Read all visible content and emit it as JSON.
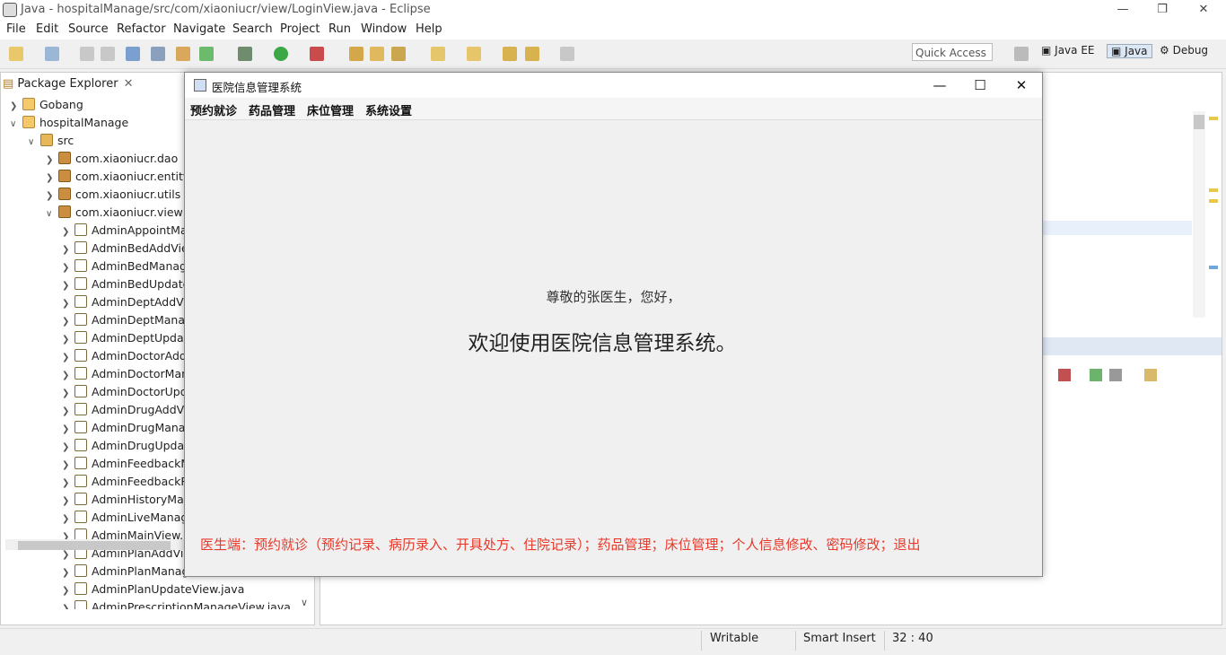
{
  "eclipse": {
    "window_title": "Java - hospitalManage/src/com/xiaoniucr/view/LoginView.java - Eclipse",
    "menu": [
      "File",
      "Edit",
      "Source",
      "Refactor",
      "Navigate",
      "Search",
      "Project",
      "Run",
      "Window",
      "Help"
    ],
    "quick_access": "Quick Access",
    "perspectives": [
      "Java EE",
      "Java",
      "Debug"
    ],
    "package_explorer": {
      "tab_label": "Package Explorer",
      "items": [
        {
          "label": "Gobang"
        },
        {
          "label": "hospitalManage"
        },
        {
          "label": "src"
        },
        {
          "label": "com.xiaoniucr.dao"
        },
        {
          "label": "com.xiaoniucr.entity"
        },
        {
          "label": "com.xiaoniucr.utils"
        },
        {
          "label": "com.xiaoniucr.view"
        },
        {
          "label": "AdminAppointMa"
        },
        {
          "label": "AdminBedAddVie"
        },
        {
          "label": "AdminBedManag"
        },
        {
          "label": "AdminBedUpdate"
        },
        {
          "label": "AdminDeptAddVi"
        },
        {
          "label": "AdminDeptManag"
        },
        {
          "label": "AdminDeptUpdat"
        },
        {
          "label": "AdminDoctorAdd"
        },
        {
          "label": "AdminDoctorMan"
        },
        {
          "label": "AdminDoctorUpd"
        },
        {
          "label": "AdminDrugAddVi"
        },
        {
          "label": "AdminDrugMana"
        },
        {
          "label": "AdminDrugUpdat"
        },
        {
          "label": "AdminFeedbackM"
        },
        {
          "label": "AdminFeedbackR"
        },
        {
          "label": "AdminHistoryMan"
        },
        {
          "label": "AdminLiveManag"
        },
        {
          "label": "AdminMainView.j"
        },
        {
          "label": "AdminPlanAddVie"
        },
        {
          "label": "AdminPlanManag"
        },
        {
          "label": "AdminPlanUpdateView.java"
        },
        {
          "label": "AdminPrescriptionManageView.java"
        }
      ]
    },
    "status": {
      "writable": "Writable",
      "insert_mode": "Smart Insert",
      "position": "32 : 40"
    }
  },
  "dialog": {
    "title": "医院信息管理系统",
    "menu": [
      "预约就诊",
      "药品管理",
      "床位管理",
      "系统设置"
    ],
    "greeting": "尊敬的张医生，您好，",
    "welcome": "欢迎使用医院信息管理系统。",
    "features": "医生端：预约就诊（预约记录、病历录入、开具处方、住院记录）；药品管理；床位管理；个人信息修改、密码修改；退出"
  }
}
